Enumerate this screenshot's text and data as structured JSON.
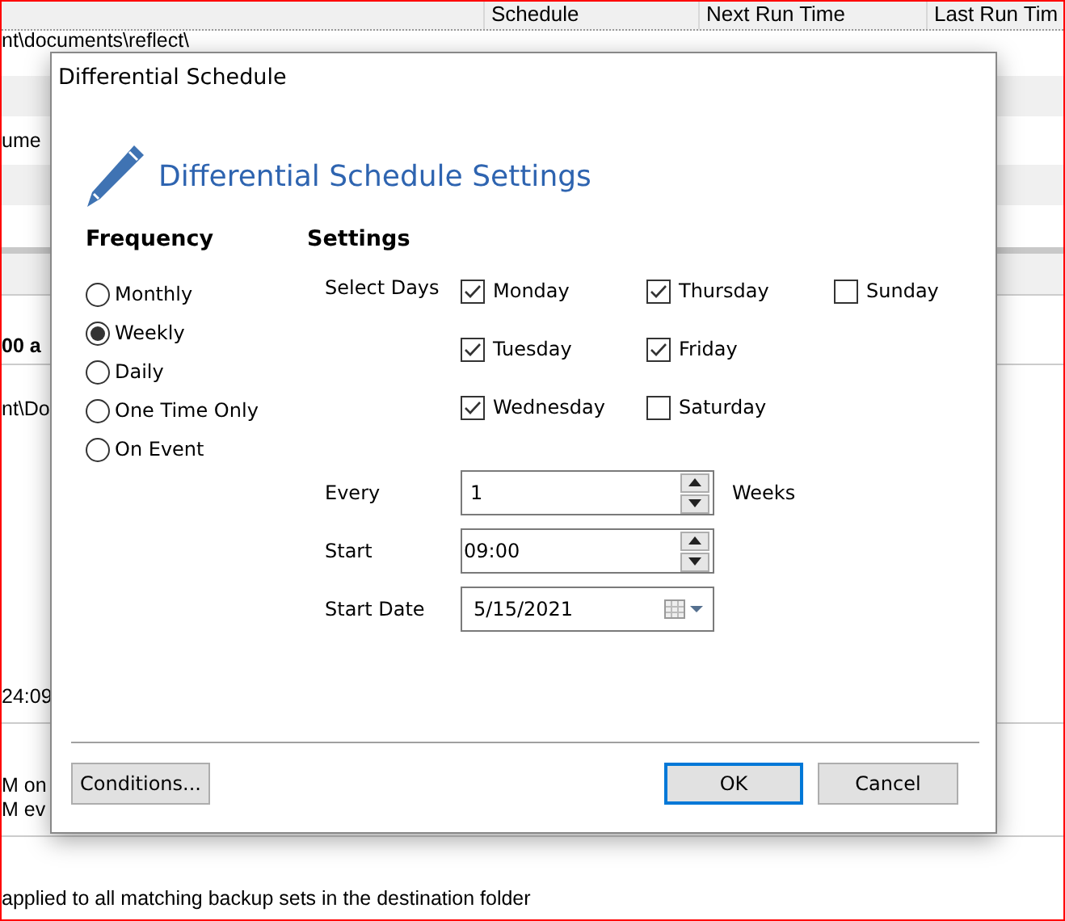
{
  "background": {
    "columns": [
      "Schedule",
      "Next Run Time",
      "Last Run Tim"
    ],
    "sections": [
      {
        "lines": [
          "nt\\documents\\reflect\\"
        ],
        "bold": false
      },
      {
        "lines": [
          "ume"
        ],
        "bold": false
      },
      {
        "lines": [
          "00 a"
        ],
        "bold": true
      },
      {
        "lines": [
          "nt\\Do",
          "24:09"
        ],
        "bold": false
      },
      {
        "lines": [
          "M on",
          "M ev"
        ],
        "bold": false
      },
      {
        "lines": [
          "applied to all matching backup sets in the destination folder"
        ],
        "bold": false
      }
    ]
  },
  "dialog": {
    "title": "Differential Schedule",
    "heading": "Differential Schedule Settings",
    "frequency": {
      "label": "Frequency",
      "options": [
        {
          "label": "Monthly",
          "selected": false
        },
        {
          "label": "Weekly",
          "selected": true
        },
        {
          "label": "Daily",
          "selected": false
        },
        {
          "label": "One Time Only",
          "selected": false
        },
        {
          "label": "On Event",
          "selected": false
        }
      ]
    },
    "settings": {
      "label": "Settings",
      "select_days_label": "Select Days",
      "days": [
        {
          "label": "Monday",
          "checked": true
        },
        {
          "label": "Thursday",
          "checked": true
        },
        {
          "label": "Sunday",
          "checked": false
        },
        {
          "label": "Tuesday",
          "checked": true
        },
        {
          "label": "Friday",
          "checked": true
        },
        {
          "label": "Wednesday",
          "checked": true
        },
        {
          "label": "Saturday",
          "checked": false
        }
      ],
      "every": {
        "label": "Every",
        "value": "1",
        "unit": "Weeks"
      },
      "start": {
        "label": "Start",
        "value": "09:00"
      },
      "start_date": {
        "label": "Start Date",
        "value": "5/15/2021"
      }
    },
    "buttons": {
      "conditions": "Conditions...",
      "ok": "OK",
      "cancel": "Cancel"
    }
  }
}
